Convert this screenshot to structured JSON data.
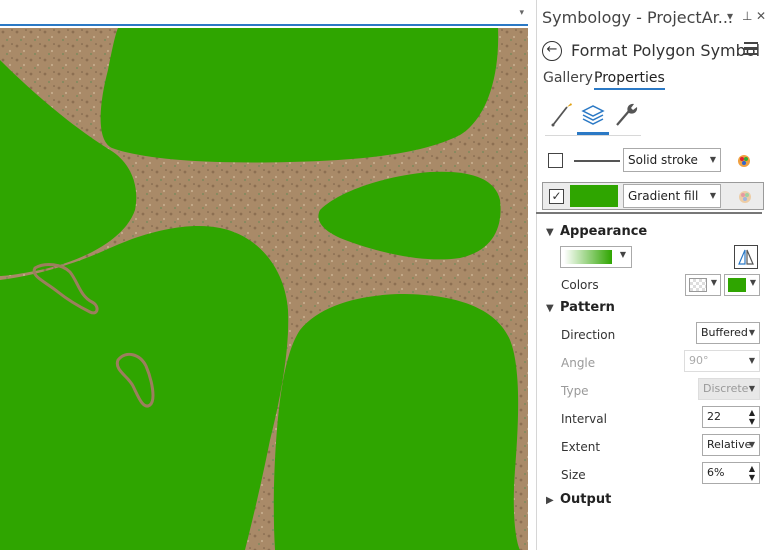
{
  "colors": {
    "accent": "#2b79c5",
    "polygon_fill": "#2fa500",
    "terrain": "#a78766",
    "track": "#8a6d50"
  },
  "map": {
    "top_dropdown_icon": "▾"
  },
  "pane": {
    "title": "Symbology - ProjectAr...",
    "controls": {
      "dropdown_icon": "▾",
      "pin_icon": "⊥",
      "close_icon": "✕"
    },
    "back_icon": "←",
    "subtitle": "Format Polygon Symbol",
    "menu_icon": "hamburger-menu-icon",
    "tabs": [
      {
        "label": "Gallery",
        "active": false
      },
      {
        "label": "Properties",
        "active": true
      }
    ],
    "tools": [
      {
        "icon": "brush-icon",
        "active": false
      },
      {
        "icon": "layers-icon",
        "active": true
      },
      {
        "icon": "wrench-icon",
        "active": false
      }
    ],
    "layers": [
      {
        "checked": false,
        "check_mark": "",
        "type": "Solid stroke",
        "swatch": "line"
      },
      {
        "checked": true,
        "check_mark": "✓",
        "type": "Gradient fill",
        "swatch": "#2fa500"
      }
    ],
    "appearance": {
      "header": "Appearance",
      "colors_label": "Colors",
      "flip_icon": "flip-gradient-icon"
    },
    "pattern": {
      "header": "Pattern",
      "direction": {
        "label": "Direction",
        "value": "Buffered"
      },
      "angle": {
        "label": "Angle",
        "value": "90°"
      },
      "type": {
        "label": "Type",
        "value": "Discrete"
      },
      "interval": {
        "label": "Interval",
        "value": "22"
      },
      "extent": {
        "label": "Extent",
        "value": "Relative"
      },
      "size": {
        "label": "Size",
        "value": "6%"
      }
    },
    "output": {
      "header": "Output"
    }
  }
}
